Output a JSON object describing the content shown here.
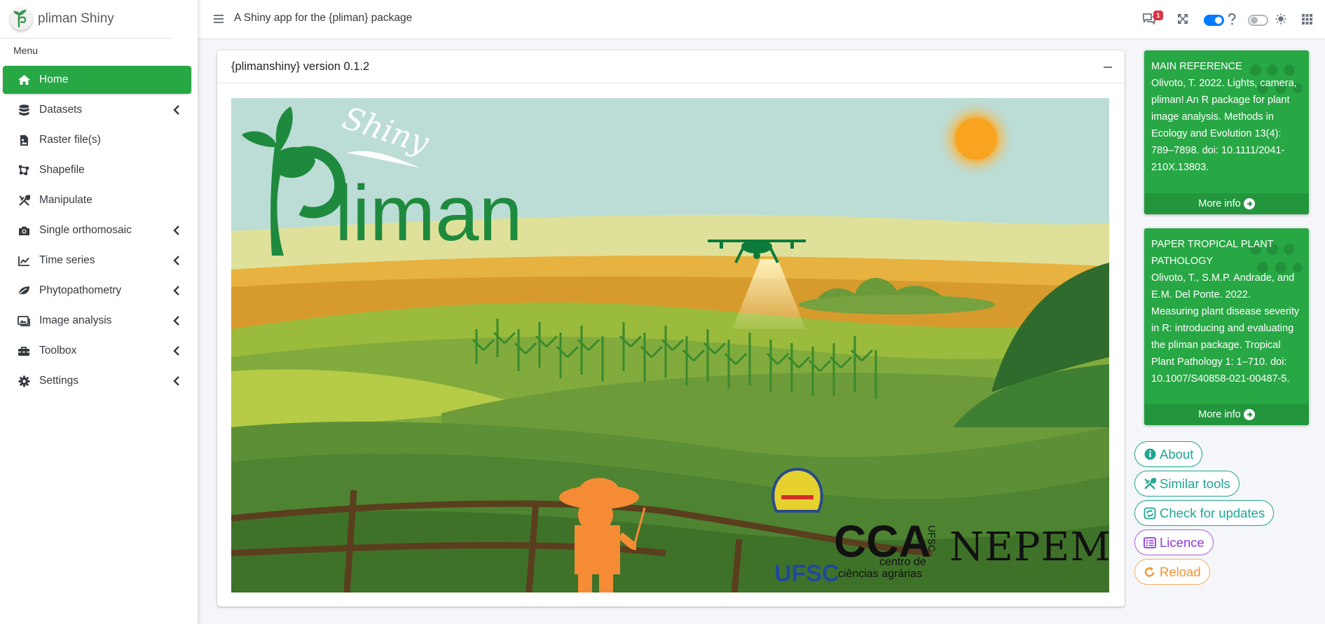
{
  "app": {
    "brand": "pliman Shiny",
    "subtitle": "A Shiny app for the {pliman} package",
    "notification_count": "1"
  },
  "sidebar": {
    "menu_header": "Menu",
    "items": [
      {
        "label": "Home",
        "icon": "home-icon",
        "active": true
      },
      {
        "label": "Datasets",
        "icon": "database-icon",
        "expandable": true
      },
      {
        "label": "Raster file(s)",
        "icon": "file-image-icon"
      },
      {
        "label": "Shapefile",
        "icon": "draw-polygon-icon"
      },
      {
        "label": "Manipulate",
        "icon": "tools-icon"
      },
      {
        "label": "Single orthomosaic",
        "icon": "camera-icon",
        "expandable": true
      },
      {
        "label": "Time series",
        "icon": "chart-line-icon",
        "expandable": true
      },
      {
        "label": "Phytopathometry",
        "icon": "leaf-icon",
        "expandable": true
      },
      {
        "label": "Image analysis",
        "icon": "images-icon",
        "expandable": true
      },
      {
        "label": "Toolbox",
        "icon": "toolbox-icon",
        "expandable": true
      },
      {
        "label": "Settings",
        "icon": "gear-icon",
        "expandable": true
      }
    ]
  },
  "main": {
    "card_title": "{plimanshiny} version 0.1.2",
    "banner": {
      "logo_word": "liman",
      "logo_script": "Shiny",
      "ufsc": "UFSC",
      "cca": "CCA",
      "cca_side": "UFSC",
      "cca_sub_1": "centro de",
      "cca_sub_2": "ciências agrárias",
      "nepem": "NEPEM"
    }
  },
  "references": [
    {
      "title": "MAIN REFERENCE",
      "body": "Olivoto, T. 2022. Lights, camera, pliman! An R package for plant image analysis. Methods in Ecology and Evolution 13(4): 789–7898. doi: 10.1111/2041-210X.13803.",
      "footer": "More info"
    },
    {
      "title": "PAPER TROPICAL PLANT PATHOLOGY",
      "body": "Olivoto, T., S.M.P. Andrade, and E.M. Del Ponte. 2022. Measuring plant disease severity in R: introducing and evaluating the pliman package. Tropical Plant Pathology 1: 1–710. doi: 10.1007/S40858-021-00487-5.",
      "footer": "More info"
    }
  ],
  "actions": {
    "about": "About",
    "similar": "Similar tools",
    "updates": "Check for updates",
    "licence": "Licence",
    "reload": "Reload"
  },
  "colors": {
    "accent_green": "#28a745",
    "teal": "#20a591",
    "purple": "#8b3ad6",
    "orange": "#f29336",
    "toggle_blue": "#007bff"
  }
}
